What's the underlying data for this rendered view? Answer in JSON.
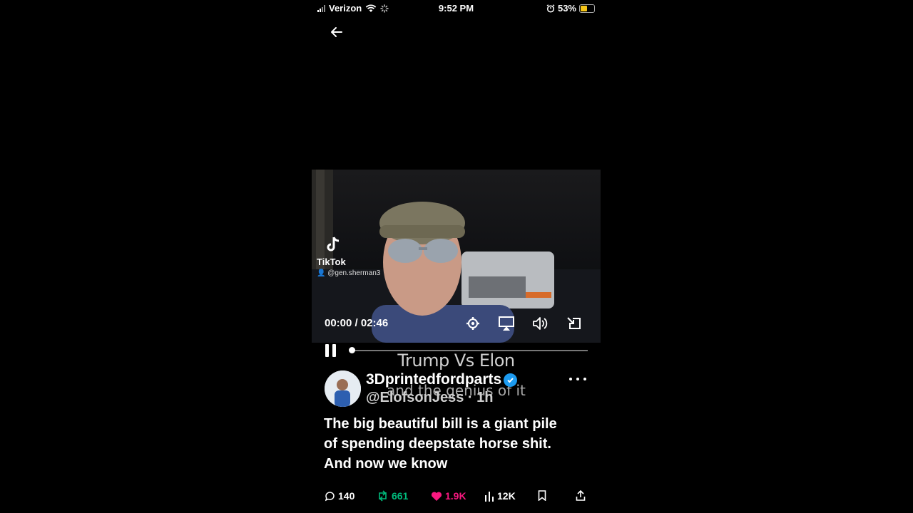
{
  "status_bar": {
    "carrier": "Verizon",
    "time": "9:52 PM",
    "battery": "53%",
    "battery_level": 0.53,
    "icons": [
      "signal-icon",
      "wifi-icon",
      "loading-icon",
      "alarm-icon",
      "battery-icon"
    ]
  },
  "nav": {
    "back_icon": "arrow-left-icon"
  },
  "video": {
    "watermark_brand": "TikTok",
    "watermark_handle": "@gen.sherman3",
    "current_time": "00:00 / 02:46",
    "progress": 0.0,
    "controls": [
      "gear-icon",
      "airplay-icon",
      "volume-icon",
      "pip-icon"
    ]
  },
  "captions": {
    "line1": "Trump Vs Elon",
    "line2": "and the genius of it"
  },
  "post": {
    "display_name": "3Dprintedfordparts",
    "handle_time": "@ElofsonJess · 1h",
    "text": "The big beautiful bill is a giant pile\nof spending deepstate horse shit.\nAnd now we know",
    "verified_color": "#1d9bf0"
  },
  "actions": {
    "replies": "140",
    "reposts": "661",
    "likes": "1.9K",
    "views": "12K",
    "repost_color": "#00ba7c",
    "like_color": "#f91880"
  }
}
